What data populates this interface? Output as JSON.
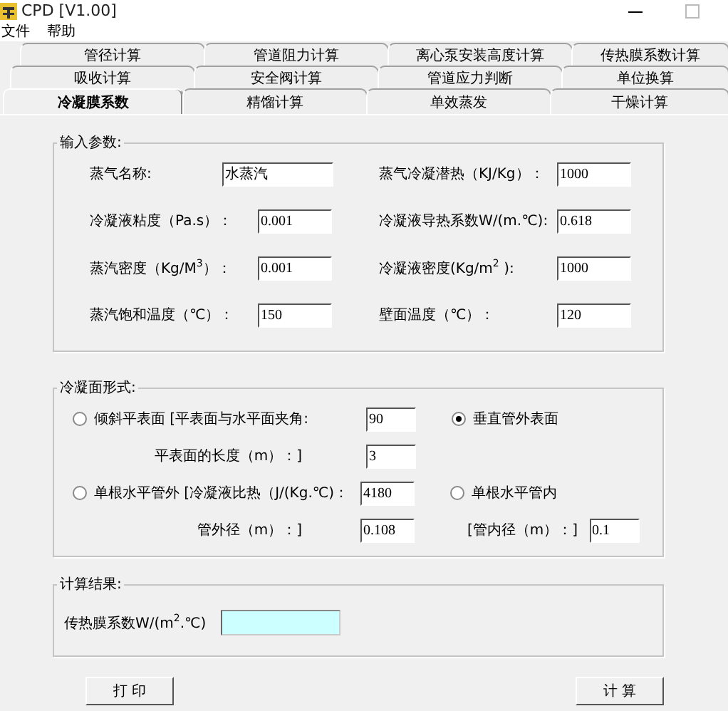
{
  "window": {
    "title": "CPD [V1.00]"
  },
  "menu": [
    "文件",
    "帮助"
  ],
  "tab_rows": [
    [
      {
        "label": "管径计算",
        "selected": false
      },
      {
        "label": "管道阻力计算",
        "selected": false
      },
      {
        "label": "离心泵安装高度计算",
        "selected": false
      },
      {
        "label": "传热膜系数计算",
        "selected": false
      }
    ],
    [
      {
        "label": "吸收计算",
        "selected": false
      },
      {
        "label": "安全阀计算",
        "selected": false
      },
      {
        "label": "管道应力判断",
        "selected": false
      },
      {
        "label": "单位换算",
        "selected": false
      }
    ],
    [
      {
        "label": "冷凝膜系数",
        "selected": true
      },
      {
        "label": "精馏计算",
        "selected": false
      },
      {
        "label": "单效蒸发",
        "selected": false
      },
      {
        "label": "干燥计算",
        "selected": false
      }
    ]
  ],
  "input_params": {
    "title": "输入参数:",
    "fields": [
      {
        "label": "蒸气名称:",
        "value": "水蒸汽"
      },
      {
        "label": "蒸气冷凝潜热（KJ/Kg）：",
        "value": "1000"
      },
      {
        "label": "冷凝液粘度（Pa.s）：",
        "value": "0.001"
      },
      {
        "label": "冷凝液导热系数W/(m.℃):",
        "value": "0.618"
      },
      {
        "label": "蒸汽密度（Kg/M$^{3}$）：",
        "value": "0.001"
      },
      {
        "label": "冷凝液密度(Kg/m$^{2}$ ):",
        "value": "1000"
      },
      {
        "label": "蒸汽饱和温度（℃）：",
        "value": "150"
      },
      {
        "label": "壁面温度（℃）：",
        "value": "120"
      }
    ]
  },
  "condensing_surface": {
    "title": "冷凝面形式:",
    "rows": [
      {
        "radio": {
          "label": "倾斜平表面 [平表面与水平面夹角:",
          "selected": false
        },
        "value": "90",
        "side_radio": {
          "label": "垂直管外表面",
          "selected": true
        }
      },
      {
        "label": "平表面的长度（m）：]",
        "value": "3"
      },
      {
        "radio": {
          "label": "单根水平管外 [冷凝液比热（J/(Kg.℃)：",
          "selected": false
        },
        "value": "4180",
        "side_radio": {
          "label": "单根水平管内",
          "selected": false
        }
      },
      {
        "label": "管外径（m）：]",
        "value": "0.108",
        "side_label": "[管内径（m）：]",
        "side_value": "0.1"
      }
    ]
  },
  "result": {
    "title": "计算结果:",
    "label": "传热膜系数W/(m$^{2}$.℃)"
  },
  "buttons": [
    "打 印",
    "计 算"
  ]
}
